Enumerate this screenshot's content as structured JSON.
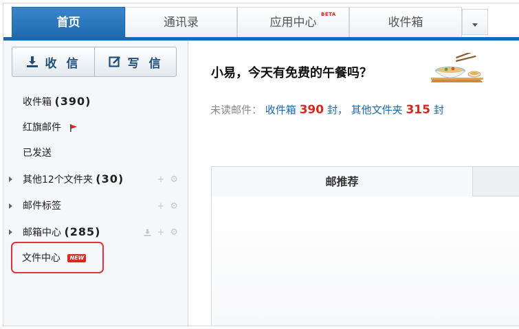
{
  "tabs": [
    {
      "label": "首页",
      "active": true
    },
    {
      "label": "通讯录",
      "active": false
    },
    {
      "label": "应用中心",
      "active": false,
      "badge": "BETA"
    },
    {
      "label": "收件箱",
      "active": false
    }
  ],
  "sidebar": {
    "receive_label": "收 信",
    "write_label": "写 信",
    "items": [
      {
        "label": "收件箱",
        "count": "(390)"
      },
      {
        "label": "红旗邮件"
      },
      {
        "label": "已发送"
      },
      {
        "label": "其他12个文件夹",
        "count": "(30)"
      },
      {
        "label": "邮件标签"
      },
      {
        "label": "邮箱中心",
        "count": "(285)"
      },
      {
        "label": "文件中心",
        "badge": "NEW"
      }
    ]
  },
  "main": {
    "greeting": "小易，今天有免费的午餐吗？",
    "unread_label": "未读邮件：",
    "inbox_link": "收件箱",
    "inbox_count": "390",
    "unit1": "封，",
    "other_link": "其他文件夹",
    "other_count": "315",
    "unit2": "封",
    "recommend_tab": "邮推荐"
  },
  "colors": {
    "accent": "#1d67ab",
    "alert": "#d8281f",
    "highlight": "#e0323a"
  }
}
